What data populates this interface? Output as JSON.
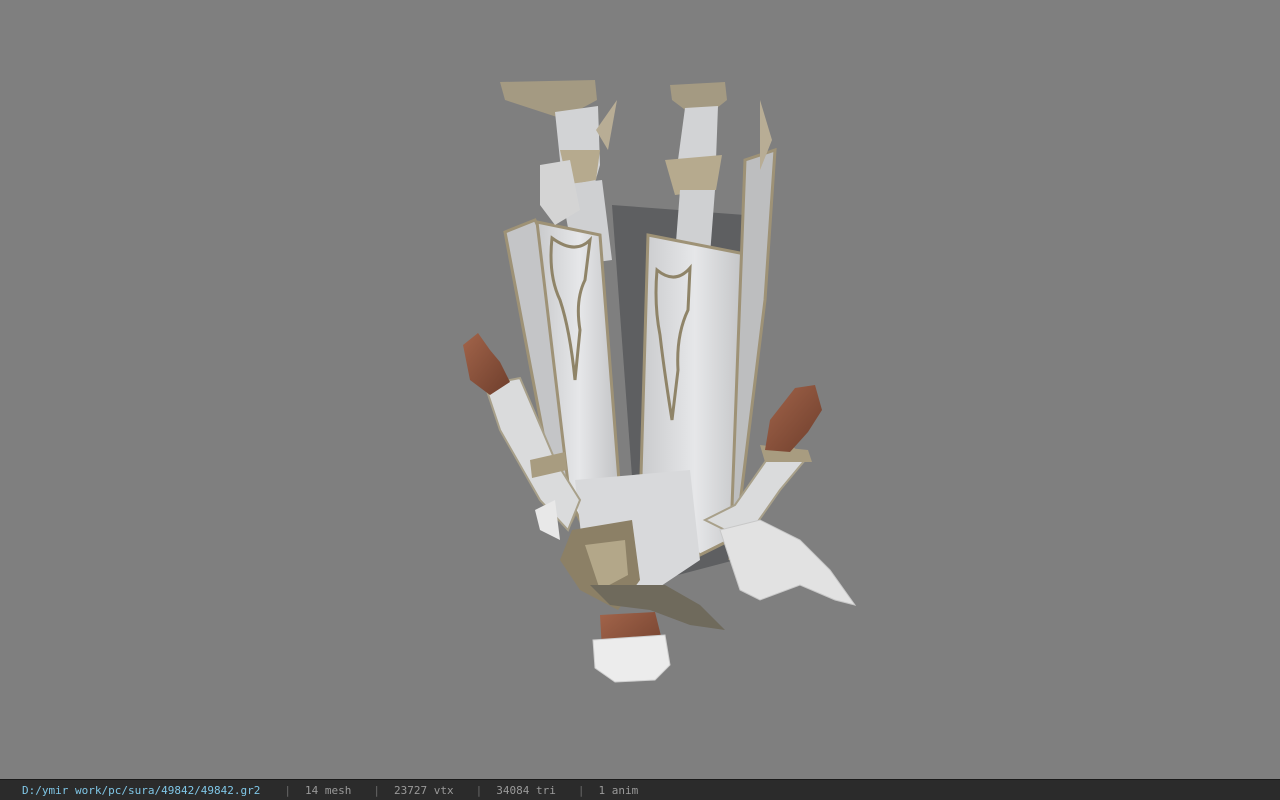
{
  "viewport": {
    "background": "#7f7f7f",
    "model_description_icon": "upside-down-character-model"
  },
  "statusbar": {
    "file_path": "D:/ymir work/pc/sura/49842/49842.gr2",
    "separator": "|",
    "mesh_count": "14 mesh",
    "vertex_count": "23727 vtx",
    "triangle_count": "34084 tri",
    "anim_count": "1 anim",
    "path_color": "#7fc6e6",
    "text_color": "#9a9a9a"
  }
}
